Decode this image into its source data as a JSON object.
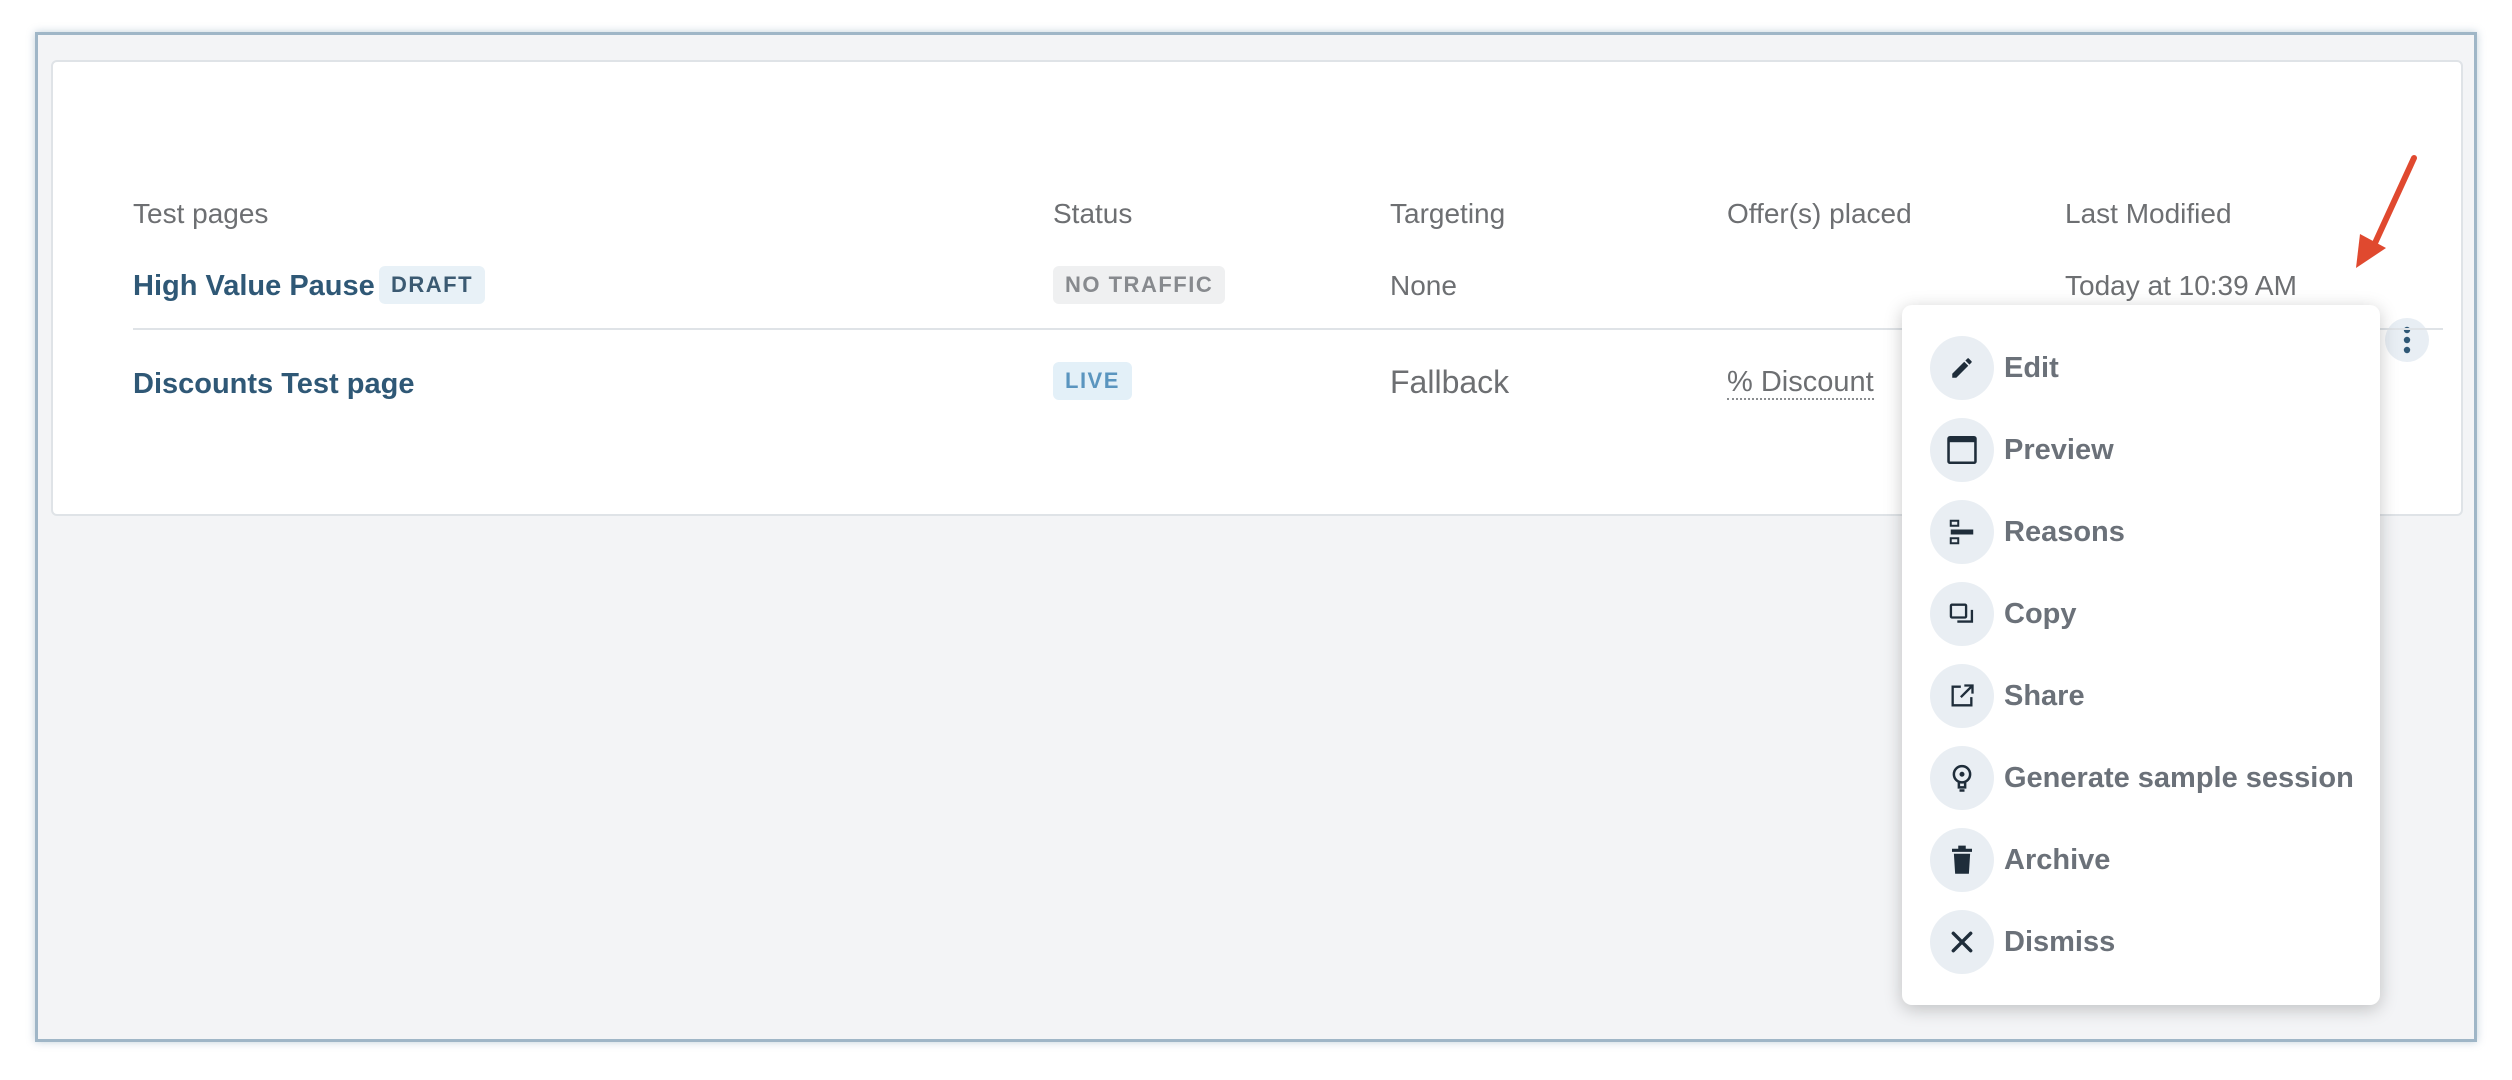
{
  "table": {
    "headers": {
      "test_pages": "Test pages",
      "status": "Status",
      "targeting": "Targeting",
      "offers": "Offer(s) placed",
      "last_modified": "Last Modified"
    },
    "rows": [
      {
        "name": "High Value Pause",
        "tag": "DRAFT",
        "status": "NO TRAFFIC",
        "targeting": "None",
        "offer": "",
        "last_modified": "Today at 10:39 AM"
      },
      {
        "name": "Discounts Test page",
        "tag": "",
        "status": "LIVE",
        "targeting": "Fallback",
        "offer": "% Discount",
        "last_modified": ""
      }
    ]
  },
  "row_menu": {
    "trigger_icon": "kebab-vertical-icon",
    "items": [
      {
        "label": "Edit",
        "icon": "pencil-icon"
      },
      {
        "label": "Preview",
        "icon": "window-icon"
      },
      {
        "label": "Reasons",
        "icon": "reasons-icon"
      },
      {
        "label": "Copy",
        "icon": "copy-icon"
      },
      {
        "label": "Share",
        "icon": "share-icon"
      },
      {
        "label": "Generate sample session",
        "icon": "lightbulb-icon"
      },
      {
        "label": "Archive",
        "icon": "trash-icon"
      },
      {
        "label": "Dismiss",
        "icon": "close-icon"
      }
    ]
  },
  "colors": {
    "link": "#2f5876",
    "annotation_arrow": "#e0492f"
  }
}
